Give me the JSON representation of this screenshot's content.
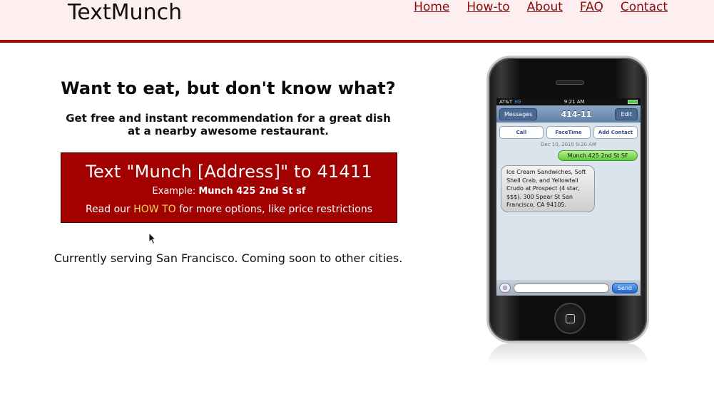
{
  "header": {
    "logo": "TextMunch",
    "nav": [
      "Home",
      "How-to",
      "About",
      "FAQ",
      "Contact"
    ]
  },
  "main": {
    "headline": "Want to eat, but don't know what?",
    "subline_1": "Get free and instant recommendation for a great dish",
    "subline_2": "at a nearby awesome restaurant.",
    "cta": {
      "main": "Text \"Munch [Address]\" to 41411",
      "example_label": "Example:",
      "example_value": "Munch 425 2nd St sf",
      "more_prefix": "Read our",
      "more_link": "HOW TO",
      "more_suffix": "for more options, like price restrictions"
    },
    "serving": "Currently serving San Francisco. Coming soon to other cities."
  },
  "phone": {
    "status_carrier": "AT&T",
    "status_network": "3G",
    "status_time": "9:21 AM",
    "back_label": "Messages",
    "number": "414-11",
    "edit_label": "Edit",
    "action_call": "Call",
    "action_facetime": "FaceTime",
    "action_add_contact": "Add Contact",
    "date": "Dec 10, 2010 9:20 AM",
    "sent": "Munch 425 2nd St SF",
    "received": "Ice Cream Sandwiches, Soft Shell Crab, and Yellowtail Crudo at Prospect (4 star, $$$). 300 Spear St San Francisco, CA 94105.",
    "send_label": "Send"
  },
  "colors": {
    "header_bg": "#fdefef",
    "accent_red": "#a30000",
    "nav_link": "#8b0b0b",
    "howto_link": "#f2dc4a"
  }
}
